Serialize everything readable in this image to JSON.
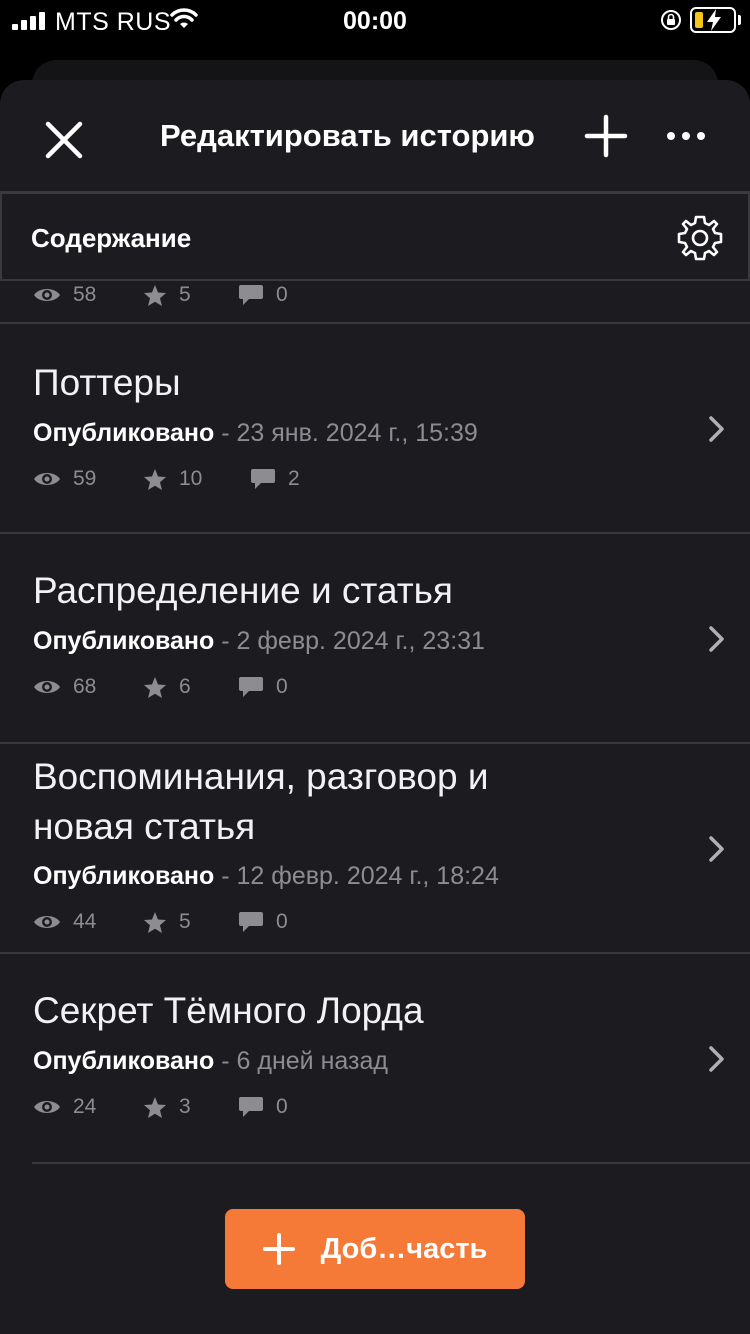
{
  "status_bar": {
    "carrier": "MTS RUS",
    "time": "00:00",
    "battery_color": "#f5c518"
  },
  "header": {
    "title": "Редактировать историю",
    "close_icon": "close-icon",
    "add_icon": "plus-icon",
    "more_icon": "more-horizontal-icon"
  },
  "section": {
    "label": "Содержание",
    "settings_icon": "gear-icon"
  },
  "partial_item": {
    "views": "58",
    "votes": "5",
    "comments": "0"
  },
  "parts": [
    {
      "title": "Поттеры",
      "status": "Опубликовано",
      "separator": " - ",
      "date": "23 янв. 2024 г., 15:39",
      "views": "59",
      "votes": "10",
      "comments": "2"
    },
    {
      "title": "Распределение и статья",
      "status": "Опубликовано",
      "separator": " - ",
      "date": "2 февр. 2024 г., 23:31",
      "views": "68",
      "votes": "6",
      "comments": "0"
    },
    {
      "title": "Воспоминания, разговор и новая статья",
      "title_line1": "Воспоминания, разговор и",
      "title_line2": "новая статья",
      "status": "Опубликовано",
      "separator": " - ",
      "date": "12 февр. 2024 г., 18:24",
      "views": "44",
      "votes": "5",
      "comments": "0"
    },
    {
      "title": "Секрет Тёмного Лорда",
      "status": "Опубликовано",
      "separator": " - ",
      "date": "6 дней назад",
      "views": "24",
      "votes": "3",
      "comments": "0"
    }
  ],
  "add_part_button": {
    "label": "Доб…часть",
    "accent": "#f57a38"
  }
}
